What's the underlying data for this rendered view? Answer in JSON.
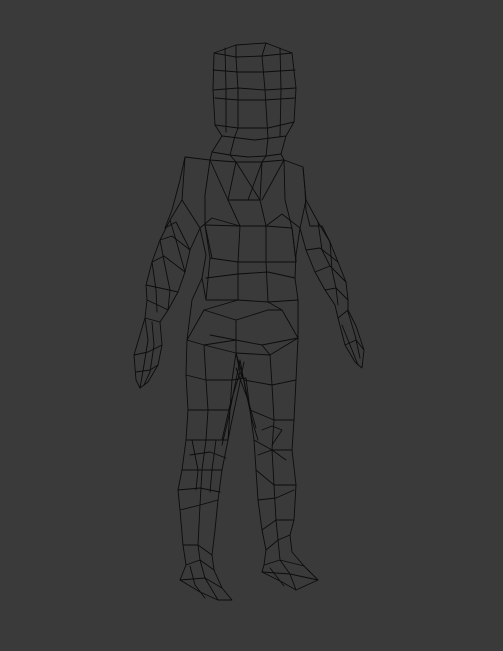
{
  "viewport": {
    "background": "#3a3a3a",
    "wire_color": "#0c0c0c",
    "mode": "wireframe"
  },
  "object": {
    "icon": "humanoid-mesh-icon"
  }
}
